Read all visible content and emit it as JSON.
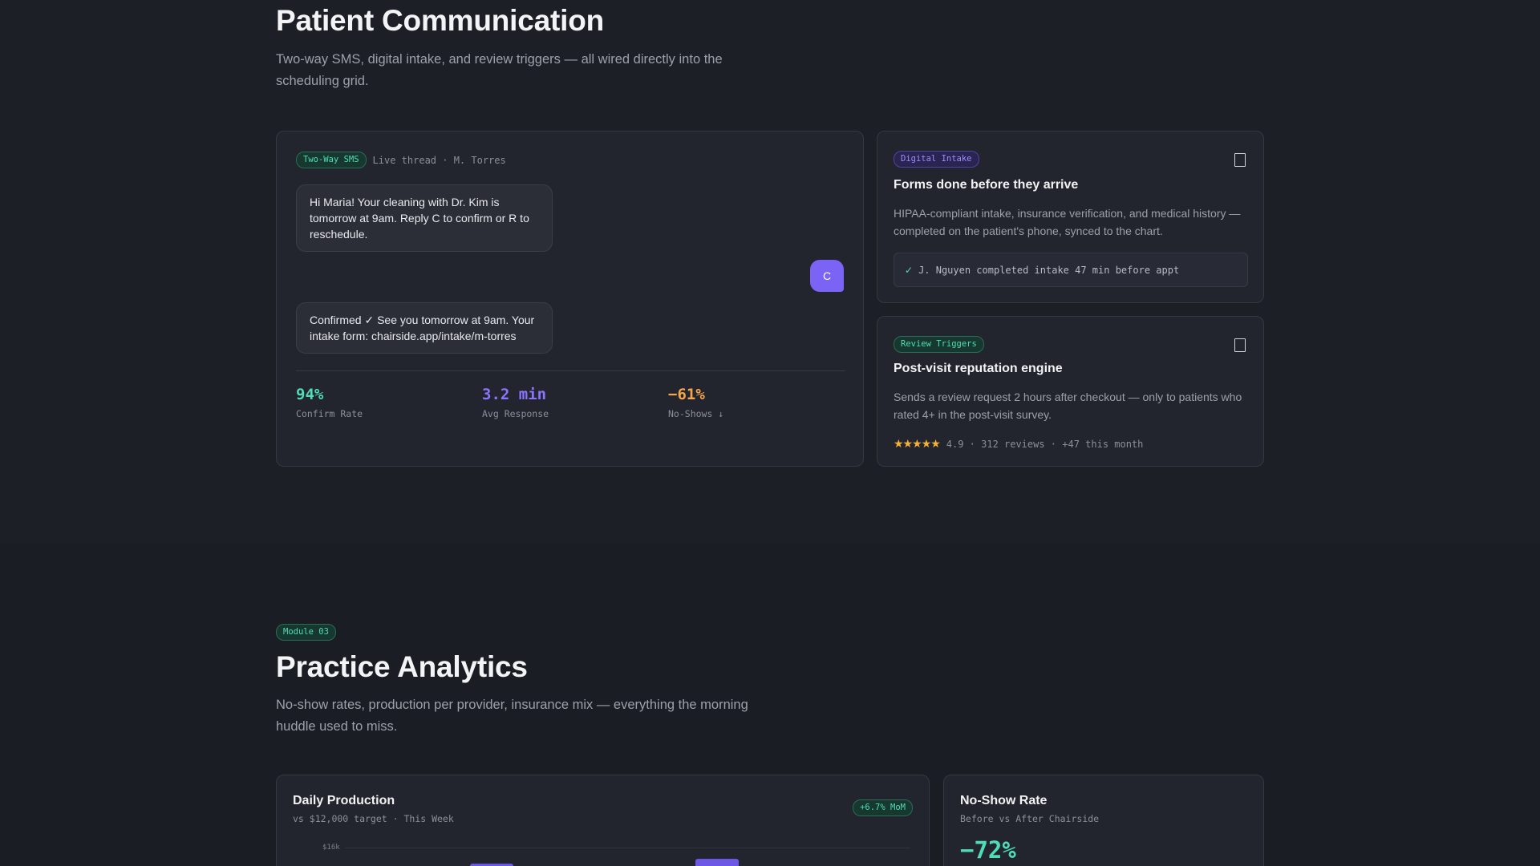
{
  "comm": {
    "title": "Patient Communication",
    "subtitle": "Two-way SMS, digital intake, and review triggers — all wired directly into the scheduling grid.",
    "sms": {
      "badge": "Two-Way SMS",
      "thread_label": "Live thread · M. Torres",
      "msg1": "Hi Maria! Your cleaning with Dr. Kim is tomorrow at 9am. Reply C to confirm or R to reschedule.",
      "reply": "C",
      "msg2": "Confirmed ✓ See you tomorrow at 9am. Your intake form: chairside.app/intake/m-torres",
      "stats": [
        {
          "value": "94%",
          "label": "Confirm Rate",
          "color": "#4fdcb6"
        },
        {
          "value": "3.2 min",
          "label": "Avg Response",
          "color": "#8b74ff"
        },
        {
          "value": "−61%",
          "label": "No-Shows ↓",
          "color": "#f5a54a"
        }
      ]
    },
    "intake": {
      "badge": "Digital Intake",
      "heading": "Forms done before they arrive",
      "body": "HIPAA-compliant intake, insurance verification, and medical history — completed on the patient's phone, synced to the chart.",
      "status_check": "✓",
      "status_text": "J. Nguyen completed intake 47 min before appt"
    },
    "reviews": {
      "badge": "Review Triggers",
      "heading": "Post-visit reputation engine",
      "body": "Sends a review request 2 hours after checkout — only to patients who rated 4+ in the post-visit survey.",
      "stars": "★★★★★",
      "rating_text": "4.9 · 312 reviews · +47 this month"
    }
  },
  "analytics": {
    "module_badge": "Module 03",
    "title": "Practice Analytics",
    "subtitle": "No-show rates, production per provider, insurance mix — everything the morning huddle used to miss.",
    "production": {
      "heading": "Daily Production",
      "sub": "vs $12,000 target · This Week",
      "badge": "+6.7% MoM",
      "tick": "$16k"
    },
    "noshow": {
      "heading": "No-Show Rate",
      "sub": "Before vs After Chairside",
      "value": "−72%"
    }
  },
  "colors": {
    "accent_green": "#4fdcb6",
    "accent_purple": "#7b63f5",
    "accent_orange": "#f5a54a",
    "star_gold": "#f5b03a"
  }
}
